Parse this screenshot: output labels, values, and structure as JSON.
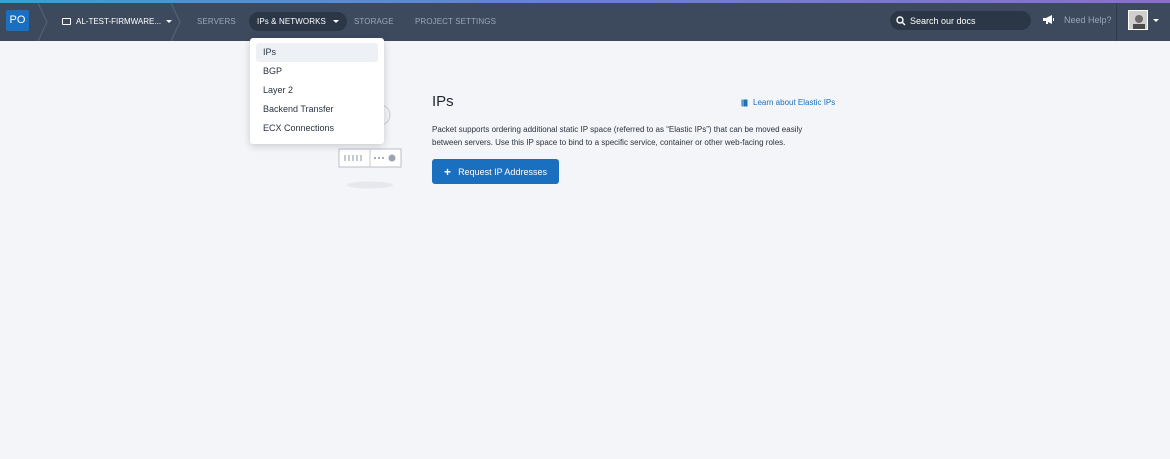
{
  "header": {
    "org_badge": "PO",
    "project_name": "AL-TEST-FIRMWARE...",
    "nav": [
      {
        "label": "SERVERS"
      },
      {
        "label": "IPs & NETWORKS"
      },
      {
        "label": "STORAGE"
      },
      {
        "label": "PROJECT SETTINGS"
      }
    ],
    "search_placeholder": "Search our docs",
    "help_label": "Need Help?",
    "icons": {
      "folder": "folder-icon",
      "search": "search-icon",
      "megaphone": "megaphone-icon",
      "avatar": "user-avatar"
    }
  },
  "dropdown": {
    "items": [
      {
        "label": "IPs",
        "selected": true
      },
      {
        "label": "BGP"
      },
      {
        "label": "Layer 2"
      },
      {
        "label": "Backend Transfer"
      },
      {
        "label": "ECX Connections"
      }
    ]
  },
  "main": {
    "title": "IPs",
    "learn_link": "Learn about Elastic IPs",
    "description": "Packet supports ordering additional static IP space (referred to as “Elastic IPs”) that can be moved easily between servers. Use this IP space to bind to a specific service, container or other web-facing roles.",
    "request_button": "Request IP Addresses"
  },
  "colors": {
    "topbar": "#3d4a5e",
    "accent_blue": "#1a6fbf",
    "background": "#f4f5f8"
  }
}
